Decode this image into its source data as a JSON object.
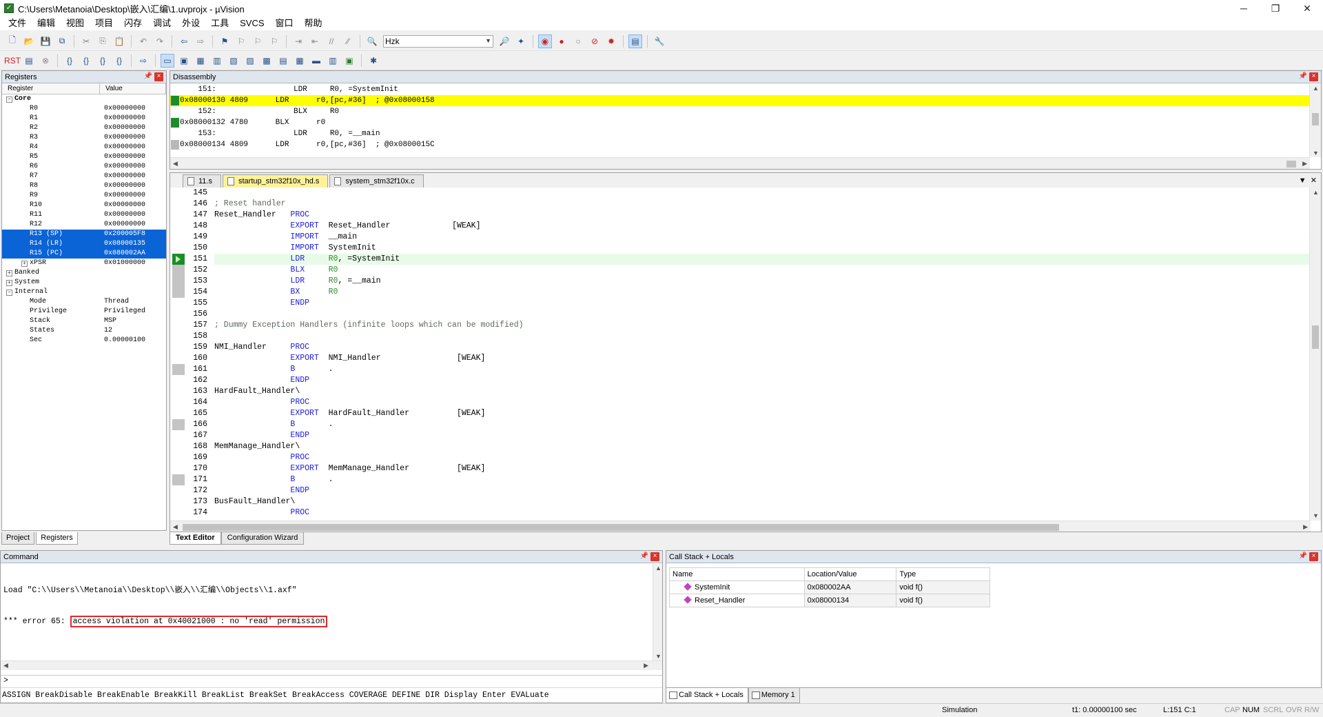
{
  "window": {
    "title": "C:\\Users\\Metanoia\\Desktop\\嵌入\\汇编\\1.uvprojx - µVision"
  },
  "menu": [
    "文件",
    "编辑",
    "视图",
    "项目",
    "闪存",
    "调试",
    "外设",
    "工具",
    "SVCS",
    "窗口",
    "帮助"
  ],
  "toolbar": {
    "target_combo": "Hzk"
  },
  "registers": {
    "title": "Registers",
    "col_register": "Register",
    "col_value": "Value",
    "core_label": "Core",
    "core": [
      {
        "name": "R0",
        "value": "0x00000000"
      },
      {
        "name": "R1",
        "value": "0x00000000"
      },
      {
        "name": "R2",
        "value": "0x00000000"
      },
      {
        "name": "R3",
        "value": "0x00000000"
      },
      {
        "name": "R4",
        "value": "0x00000000"
      },
      {
        "name": "R5",
        "value": "0x00000000"
      },
      {
        "name": "R6",
        "value": "0x00000000"
      },
      {
        "name": "R7",
        "value": "0x00000000"
      },
      {
        "name": "R8",
        "value": "0x00000000"
      },
      {
        "name": "R9",
        "value": "0x00000000"
      },
      {
        "name": "R10",
        "value": "0x00000000"
      },
      {
        "name": "R11",
        "value": "0x00000000"
      },
      {
        "name": "R12",
        "value": "0x00000000"
      },
      {
        "name": "R13 (SP)",
        "value": "0x200005F8"
      },
      {
        "name": "R14 (LR)",
        "value": "0x08000135"
      },
      {
        "name": "R15 (PC)",
        "value": "0x080002AA"
      },
      {
        "name": "xPSR",
        "value": "0x01000000"
      }
    ],
    "banked_label": "Banked",
    "system_label": "System",
    "internal_label": "Internal",
    "internal": [
      {
        "name": "Mode",
        "value": "Thread"
      },
      {
        "name": "Privilege",
        "value": "Privileged"
      },
      {
        "name": "Stack",
        "value": "MSP"
      },
      {
        "name": "States",
        "value": "12"
      },
      {
        "name": "Sec",
        "value": "0.00000100"
      }
    ]
  },
  "left_tabs": {
    "project": "Project",
    "registers": "Registers"
  },
  "disassembly": {
    "title": "Disassembly",
    "lines": [
      "    151:                 LDR     R0, =SystemInit",
      "0x08000130 4809      LDR      r0,[pc,#36]  ; @0x08000158",
      "    152:                 BLX     R0",
      "0x08000132 4780      BLX      r0",
      "    153:                 LDR     R0, =__main",
      "0x08000134 4809      LDR      r0,[pc,#36]  ; @0x0800015C"
    ]
  },
  "editor_tabs": [
    "11.s",
    "startup_stm32f10x_hd.s",
    "system_stm32f10x.c"
  ],
  "code": [
    {
      "n": "145",
      "t": ""
    },
    {
      "n": "146",
      "t": "; Reset handler"
    },
    {
      "n": "147",
      "t": "Reset_Handler   PROC"
    },
    {
      "n": "148",
      "t": "                EXPORT  Reset_Handler             [WEAK]"
    },
    {
      "n": "149",
      "t": "                IMPORT  __main"
    },
    {
      "n": "150",
      "t": "                IMPORT  SystemInit"
    },
    {
      "n": "151",
      "t": "                LDR     R0, =SystemInit"
    },
    {
      "n": "152",
      "t": "                BLX     R0"
    },
    {
      "n": "153",
      "t": "                LDR     R0, =__main"
    },
    {
      "n": "154",
      "t": "                BX      R0"
    },
    {
      "n": "155",
      "t": "                ENDP"
    },
    {
      "n": "156",
      "t": ""
    },
    {
      "n": "157",
      "t": "; Dummy Exception Handlers (infinite loops which can be modified)"
    },
    {
      "n": "158",
      "t": ""
    },
    {
      "n": "159",
      "t": "NMI_Handler     PROC"
    },
    {
      "n": "160",
      "t": "                EXPORT  NMI_Handler                [WEAK]"
    },
    {
      "n": "161",
      "t": "                B       ."
    },
    {
      "n": "162",
      "t": "                ENDP"
    },
    {
      "n": "163",
      "t": "HardFault_Handler\\"
    },
    {
      "n": "164",
      "t": "                PROC"
    },
    {
      "n": "165",
      "t": "                EXPORT  HardFault_Handler          [WEAK]"
    },
    {
      "n": "166",
      "t": "                B       ."
    },
    {
      "n": "167",
      "t": "                ENDP"
    },
    {
      "n": "168",
      "t": "MemManage_Handler\\"
    },
    {
      "n": "169",
      "t": "                PROC"
    },
    {
      "n": "170",
      "t": "                EXPORT  MemManage_Handler          [WEAK]"
    },
    {
      "n": "171",
      "t": "                B       ."
    },
    {
      "n": "172",
      "t": "                ENDP"
    },
    {
      "n": "173",
      "t": "BusFault_Handler\\"
    },
    {
      "n": "174",
      "t": "                PROC"
    }
  ],
  "editor_bottom_tabs": {
    "text_editor": "Text Editor",
    "config_wizard": "Configuration Wizard"
  },
  "command": {
    "title": "Command",
    "line1": "Load \"C:\\\\Users\\\\Metanoia\\\\Desktop\\\\嵌入\\\\汇编\\\\Objects\\\\1.axf\"",
    "line2_prefix": "*** error 65: ",
    "line2_error": "access violation at 0x40021000 : no 'read' permission",
    "prompt": ">",
    "help": "ASSIGN BreakDisable BreakEnable BreakKill BreakList BreakSet BreakAccess COVERAGE DEFINE DIR Display Enter EVALuate"
  },
  "callstack": {
    "title": "Call Stack + Locals",
    "col_name": "Name",
    "col_location": "Location/Value",
    "col_type": "Type",
    "rows": [
      {
        "name": "SystemInit",
        "location": "0x080002AA",
        "type": "void f()"
      },
      {
        "name": "Reset_Handler",
        "location": "0x08000134",
        "type": "void f()"
      }
    ]
  },
  "right_tabs": {
    "callstack": "Call Stack + Locals",
    "memory": "Memory 1"
  },
  "status": {
    "mode": "Simulation",
    "time": "t1: 0.00000100 sec",
    "position": "L:151 C:1",
    "cap": "CAP",
    "num": "NUM",
    "scrl": "SCRL",
    "ovr": "OVR",
    "rw": "R/W"
  }
}
